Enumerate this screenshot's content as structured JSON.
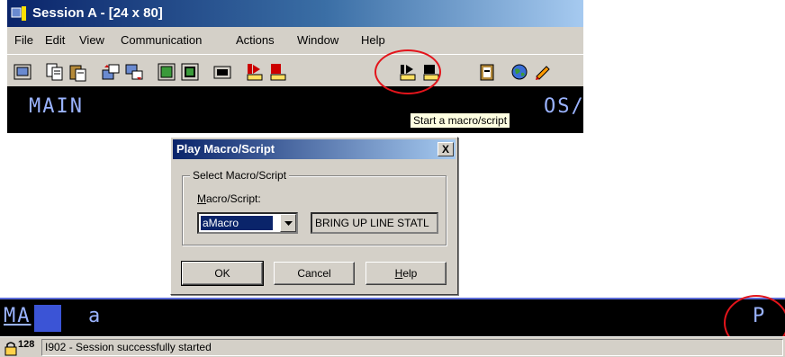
{
  "window": {
    "title": "Session A - [24 x 80]",
    "menu": [
      "File",
      "Edit",
      "View",
      "Communication",
      "Actions",
      "Window",
      "Help"
    ]
  },
  "toolbar": {
    "icons": [
      "print-screen-icon",
      "copy-icon",
      "paste-icon",
      "send-file-icon",
      "receive-file-icon",
      "display-setup-icon",
      "color-map-icon",
      "keyboard-icon",
      "record-macro-icon",
      "stop-macro-icon",
      "play-macro-icon",
      "macro-paused-icon",
      "clipboard-icon",
      "globe-icon",
      "edit-icon"
    ],
    "tooltip": "Start a macro/script"
  },
  "terminal_top": {
    "left_text": "MAIN",
    "right_text": "OS/"
  },
  "dialog": {
    "title": "Play Macro/Script",
    "close_label": "X",
    "group_label": "Select Macro/Script",
    "field_label": "Macro/Script:",
    "selected_value": "aMacro",
    "description": "BRING UP LINE STATL",
    "ok_label": "OK",
    "cancel_label": "Cancel",
    "help_label": "Help"
  },
  "terminal_bottom": {
    "left_text": "MA",
    "cursor_text": "a",
    "right_text": "P"
  },
  "status": {
    "number": "128",
    "message": "I902 - Session successfully started"
  },
  "colors": {
    "titlebar": "#0a246a",
    "terminal_bg": "#000000",
    "terminal_text": "#9ab3ff",
    "annotation": "#e3141b",
    "tooltip_bg": "#ffffe1"
  }
}
